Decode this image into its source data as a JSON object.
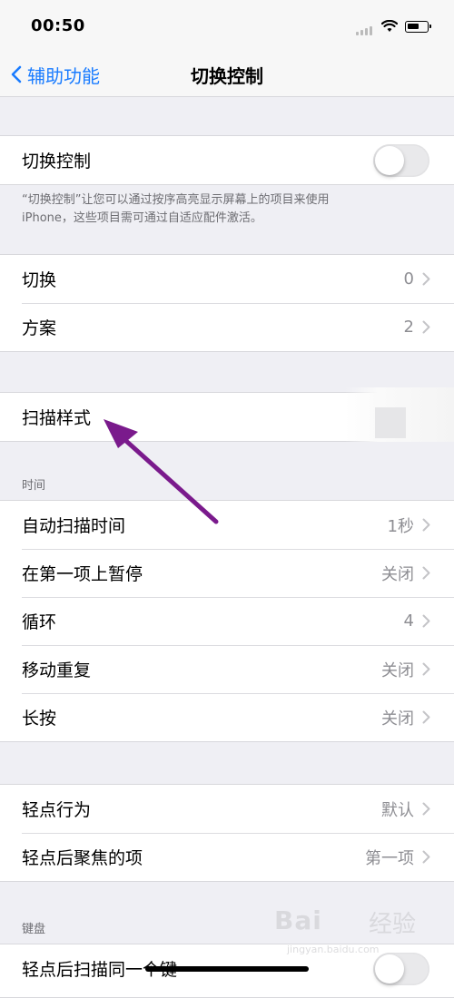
{
  "status_bar": {
    "time": "00:50"
  },
  "nav": {
    "back_label": "辅助功能",
    "title": "切换控制"
  },
  "section1": {
    "toggle_label": "切换控制",
    "toggle_on": false,
    "note_line1": "“切换控制”让您可以通过按序高亮显示屏幕上的项目来使用",
    "note_line2": "iPhone，这些项目需可通过自适应配件激活。"
  },
  "section2": {
    "rows": [
      {
        "label": "切换",
        "value": "0"
      },
      {
        "label": "方案",
        "value": "2"
      }
    ]
  },
  "section3": {
    "label": "扫描样式"
  },
  "timing": {
    "header": "时间",
    "rows": [
      {
        "label": "自动扫描时间",
        "value": "1秒"
      },
      {
        "label": "在第一项上暂停",
        "value": "关闭"
      },
      {
        "label": "循环",
        "value": "4"
      },
      {
        "label": "移动重复",
        "value": "关闭"
      },
      {
        "label": "长按",
        "value": "关闭"
      }
    ]
  },
  "tap": {
    "rows": [
      {
        "label": "轻点行为",
        "value": "默认"
      },
      {
        "label": "轻点后聚焦的项",
        "value": "第一项"
      }
    ]
  },
  "keyboard": {
    "header": "键盘",
    "row_label": "轻点后扫描同一个键"
  },
  "watermark": {
    "logo": "Bai",
    "logo_cn": "经验",
    "sub": "jingyan.baidu.com"
  },
  "colors": {
    "accent": "#1a7cff",
    "annotation_arrow": "#7a1a8c",
    "background": "#efeff4"
  }
}
